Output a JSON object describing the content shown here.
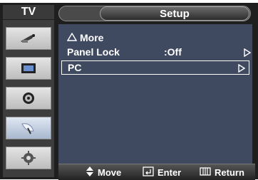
{
  "header": {
    "tab_label": "TV",
    "title": "Setup"
  },
  "sidebar": {
    "items": [
      {
        "icon": "antenna-icon"
      },
      {
        "icon": "picture-icon"
      },
      {
        "icon": "sound-icon"
      },
      {
        "icon": "satellite-dish-icon",
        "active": true
      },
      {
        "icon": "settings-gear-icon"
      }
    ]
  },
  "menu": {
    "items": [
      {
        "label": "More",
        "icon": "up-triangle-icon"
      },
      {
        "label": "Panel Lock",
        "value": ":Off"
      },
      {
        "label": "PC",
        "selected": true
      }
    ]
  },
  "help": {
    "move_label": "Move",
    "enter_label": "Enter",
    "return_label": "Return"
  },
  "colors": {
    "panel": "#3f4a60",
    "frame": "#1f1f1f",
    "sidebar": "#3d3d3d"
  }
}
